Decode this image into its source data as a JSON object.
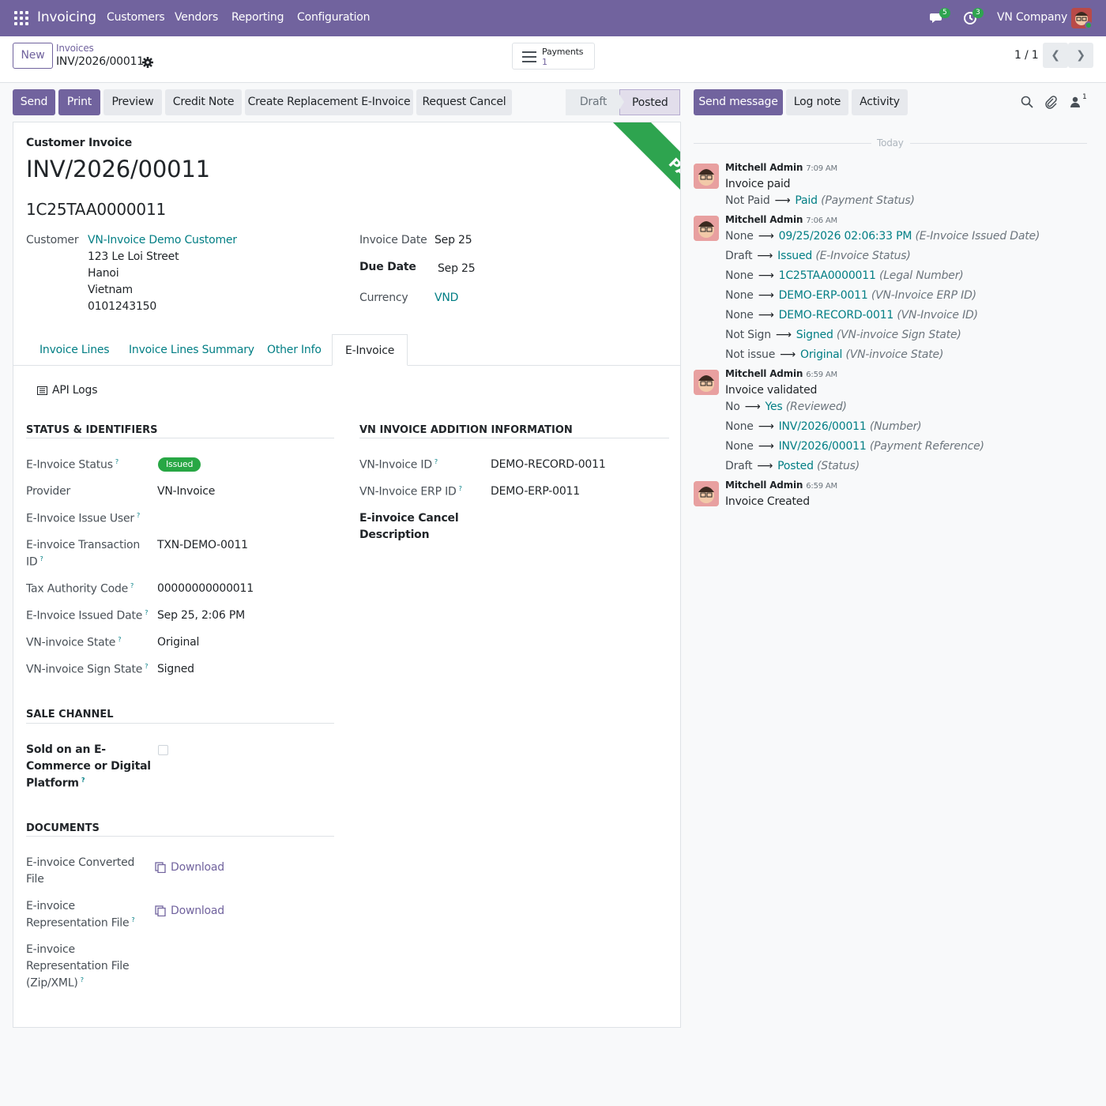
{
  "topbar": {
    "app_name": "Invoicing",
    "menu": [
      "Customers",
      "Vendors",
      "Reporting",
      "Configuration"
    ],
    "messages_count": "5",
    "activities_count": "3",
    "company": "VN Company",
    "bg_color": "#71639e"
  },
  "control": {
    "new_label": "New",
    "breadcrumb_parent": "Invoices",
    "breadcrumb_current": "INV/2026/00011",
    "smart_button_label": "Payments",
    "smart_button_count": "1",
    "pager": "1 / 1"
  },
  "actions": [
    "Send",
    "Print",
    "Preview",
    "Credit Note",
    "Create Replacement E-Invoice",
    "Request Cancel"
  ],
  "status": {
    "stages": [
      "Draft",
      "Posted"
    ],
    "current": "Posted"
  },
  "form": {
    "type_label": "Customer Invoice",
    "number": "INV/2026/00011",
    "legal_number": "1C25TAA0000011",
    "ribbon": "PAID",
    "customer_label": "Customer",
    "customer_name": "VN-Invoice Demo Customer",
    "address": [
      "123 Le Loi Street",
      "Hanoi",
      "Vietnam",
      "0101243150"
    ],
    "invoice_date_label": "Invoice Date",
    "invoice_date": "Sep 25",
    "due_date_label": "Due Date",
    "due_date": "Sep 25",
    "currency_label": "Currency",
    "currency": "VND"
  },
  "tabs": [
    "Invoice Lines",
    "Invoice Lines Summary",
    "Other Info",
    "E-Invoice"
  ],
  "einvoice": {
    "api_logs": "API Logs",
    "status_title": "STATUS & IDENTIFIERS",
    "status_label": "E-Invoice Status",
    "status_value": "Issued",
    "provider_label": "Provider",
    "provider_value": "VN-Invoice",
    "issue_user_label": "E-Invoice Issue User",
    "txn_label_1": "E-invoice Transaction",
    "txn_label_2": "ID",
    "txn_value": "TXN-DEMO-0011",
    "tax_label": "Tax Authority Code",
    "tax_value": "00000000000011",
    "issued_date_label": "E-Invoice Issued Date",
    "issued_date_value": "Sep 25, 2:06 PM",
    "state_label": "VN-invoice State",
    "state_value": "Original",
    "sign_label": "VN-invoice Sign State",
    "sign_value": "Signed",
    "addition_title": "VN INVOICE ADDITION INFORMATION",
    "vn_id_label": "VN-Invoice ID",
    "vn_id_value": "DEMO-RECORD-0011",
    "erp_label": "VN-Invoice ERP ID",
    "erp_value": "DEMO-ERP-0011",
    "cancel_desc_1": "E-invoice Cancel",
    "cancel_desc_2": "Description",
    "sale_title": "SALE CHANNEL",
    "sold_1": "Sold on an E-",
    "sold_2": "Commerce or Digital",
    "sold_3": "Platform",
    "docs_title": "DOCUMENTS",
    "converted_1": "E-invoice Converted",
    "converted_2": "File",
    "repr_1": "E-invoice",
    "repr_2": "Representation File",
    "zip_1": "E-invoice",
    "zip_2": "Representation File",
    "zip_3": "(Zip/XML)",
    "download": "Download"
  },
  "chatter": {
    "send_message": "Send message",
    "log_note": "Log note",
    "activity": "Activity",
    "followers": "1",
    "today": "Today",
    "messages": [
      {
        "author": "Mitchell Admin",
        "time": "7:09 AM",
        "body": "Invoice paid",
        "tracking": [
          {
            "old": "Not Paid",
            "new": "Paid",
            "field": "(Payment Status)"
          }
        ]
      },
      {
        "author": "Mitchell Admin",
        "time": "7:06 AM",
        "body": "",
        "tracking": [
          {
            "old": "None",
            "new": "09/25/2026 02:06:33 PM",
            "field": "(E-Invoice Issued Date)"
          },
          {
            "old": "Draft",
            "new": "Issued",
            "field": "(E-Invoice Status)"
          },
          {
            "old": "None",
            "new": "1C25TAA0000011",
            "field": "(Legal Number)"
          },
          {
            "old": "None",
            "new": "DEMO-ERP-0011",
            "field": "(VN-Invoice ERP ID)"
          },
          {
            "old": "None",
            "new": "DEMO-RECORD-0011",
            "field": "(VN-Invoice ID)"
          },
          {
            "old": "Not Sign",
            "new": "Signed",
            "field": "(VN-invoice Sign State)"
          },
          {
            "old": "Not issue",
            "new": "Original",
            "field": "(VN-invoice State)"
          }
        ]
      },
      {
        "author": "Mitchell Admin",
        "time": "6:59 AM",
        "body": "Invoice validated",
        "tracking": [
          {
            "old": "No",
            "new": "Yes",
            "field": "(Reviewed)"
          },
          {
            "old": "None",
            "new": "INV/2026/00011",
            "field": "(Number)"
          },
          {
            "old": "None",
            "new": "INV/2026/00011",
            "field": "(Payment Reference)"
          },
          {
            "old": "Draft",
            "new": "Posted",
            "field": "(Status)"
          }
        ]
      },
      {
        "author": "Mitchell Admin",
        "time": "6:59 AM",
        "body": "Invoice Created",
        "tracking": []
      }
    ]
  }
}
